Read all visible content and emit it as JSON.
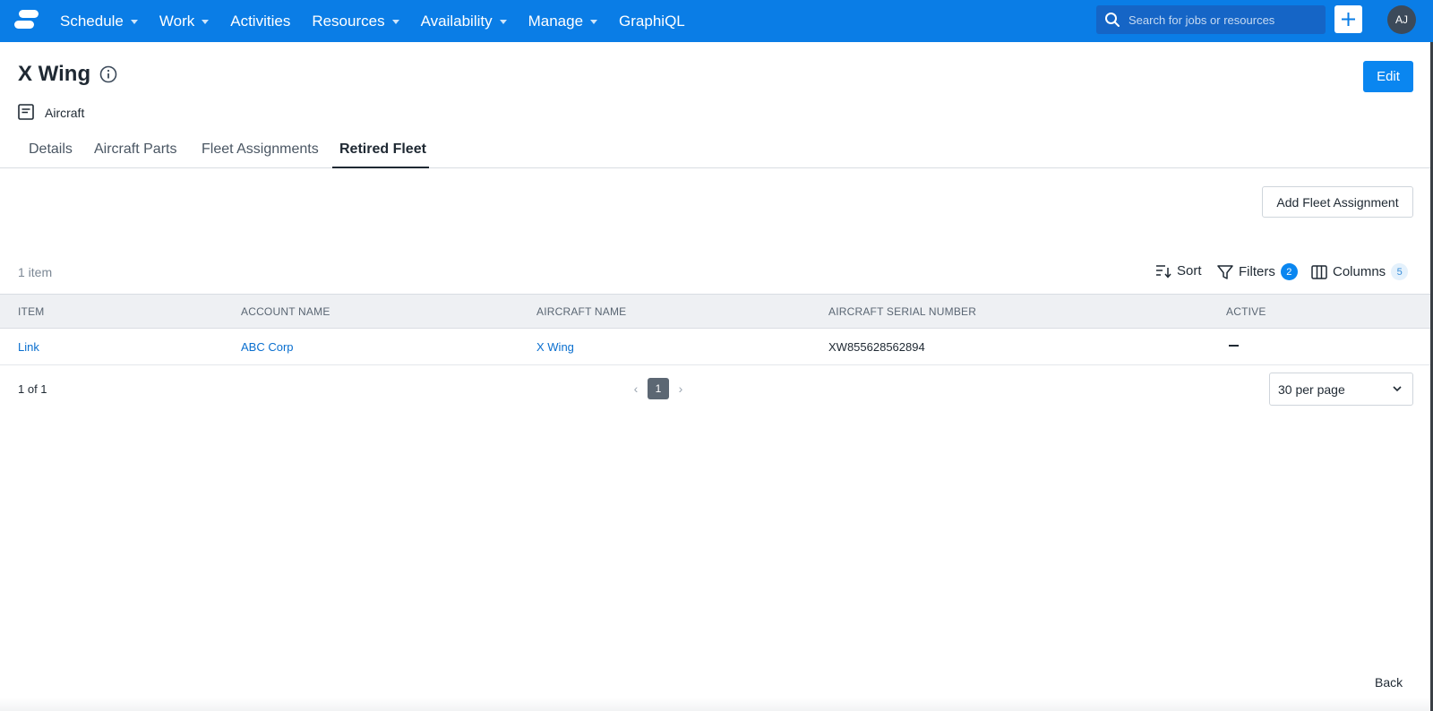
{
  "nav": {
    "items": [
      {
        "label": "Schedule",
        "has_dropdown": true
      },
      {
        "label": "Work",
        "has_dropdown": true
      },
      {
        "label": "Activities",
        "has_dropdown": false
      },
      {
        "label": "Resources",
        "has_dropdown": true
      },
      {
        "label": "Availability",
        "has_dropdown": true
      },
      {
        "label": "Manage",
        "has_dropdown": true
      },
      {
        "label": "GraphiQL",
        "has_dropdown": false
      }
    ],
    "search_placeholder": "Search for jobs or resources",
    "avatar_initials": "AJ",
    "brand_color": "#0a7de6"
  },
  "header": {
    "title": "X Wing",
    "type_label": "Aircraft",
    "edit_label": "Edit"
  },
  "tabs": [
    {
      "label": "Details",
      "active": false
    },
    {
      "label": "Aircraft Parts",
      "active": false
    },
    {
      "label": "Fleet Assignments",
      "active": false
    },
    {
      "label": "Retired Fleet",
      "active": true
    }
  ],
  "actions": {
    "add_fleet_assignment": "Add Fleet Assignment"
  },
  "toolbar": {
    "item_count": "1 item",
    "sort_label": "Sort",
    "filters_label": "Filters",
    "filters_count": "2",
    "columns_label": "Columns",
    "columns_count": "5"
  },
  "table": {
    "columns": [
      "ITEM",
      "ACCOUNT NAME",
      "AIRCRAFT NAME",
      "AIRCRAFT SERIAL NUMBER",
      "ACTIVE"
    ],
    "rows": [
      {
        "item": "Link",
        "account_name": "ABC Corp",
        "aircraft_name": "X Wing",
        "serial_number": "XW855628562894",
        "active": ""
      }
    ]
  },
  "pagination": {
    "page_of": "1 of 1",
    "current_page": "1",
    "per_page": "30 per page"
  },
  "footer": {
    "back_label": "Back"
  }
}
